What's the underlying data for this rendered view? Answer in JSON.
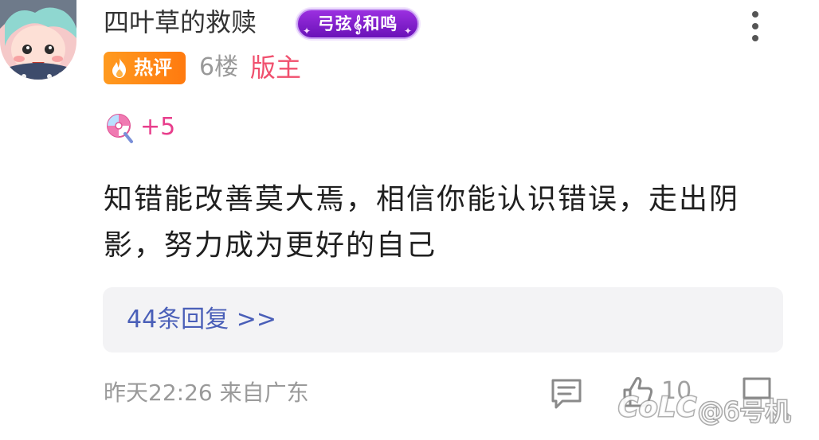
{
  "colors": {
    "username": "#333333",
    "medal_gradient": [
      "#9b2fe0",
      "#6a12b8"
    ],
    "hot_badge": "#ff8a16",
    "moderator": "#f0506e",
    "candy_count": "#e83e8c",
    "reply_link": "#4a5fb8",
    "meta": "#9a9a9a"
  },
  "post": {
    "author": {
      "name": "四叶草的救赎",
      "avatar_icon": "anime-avatar",
      "medal": {
        "icon": "treble-clef-icon",
        "label_left": "弓弦",
        "label_right": "和鸣"
      }
    },
    "more_icon": "more-vertical-icon",
    "hot_badge": {
      "icon": "fire-icon",
      "label": "热评"
    },
    "floor": "6楼",
    "role": "版主",
    "candy": {
      "icon": "candy-icon",
      "count": "+5"
    },
    "text": "知错能改善莫大焉，相信你能认识错误，走出阴影，努力成为更好的自己",
    "replies": {
      "label": "44条回复 >>"
    },
    "meta": {
      "time_location": "昨天22:26 来自广东"
    },
    "actions": {
      "comment_icon": "comment-icon",
      "like_icon": "thumbs-up-icon",
      "like_count": "10",
      "share_icon": "share-icon"
    }
  },
  "watermark": {
    "logo": "CoLC",
    "text": "@6号机"
  }
}
